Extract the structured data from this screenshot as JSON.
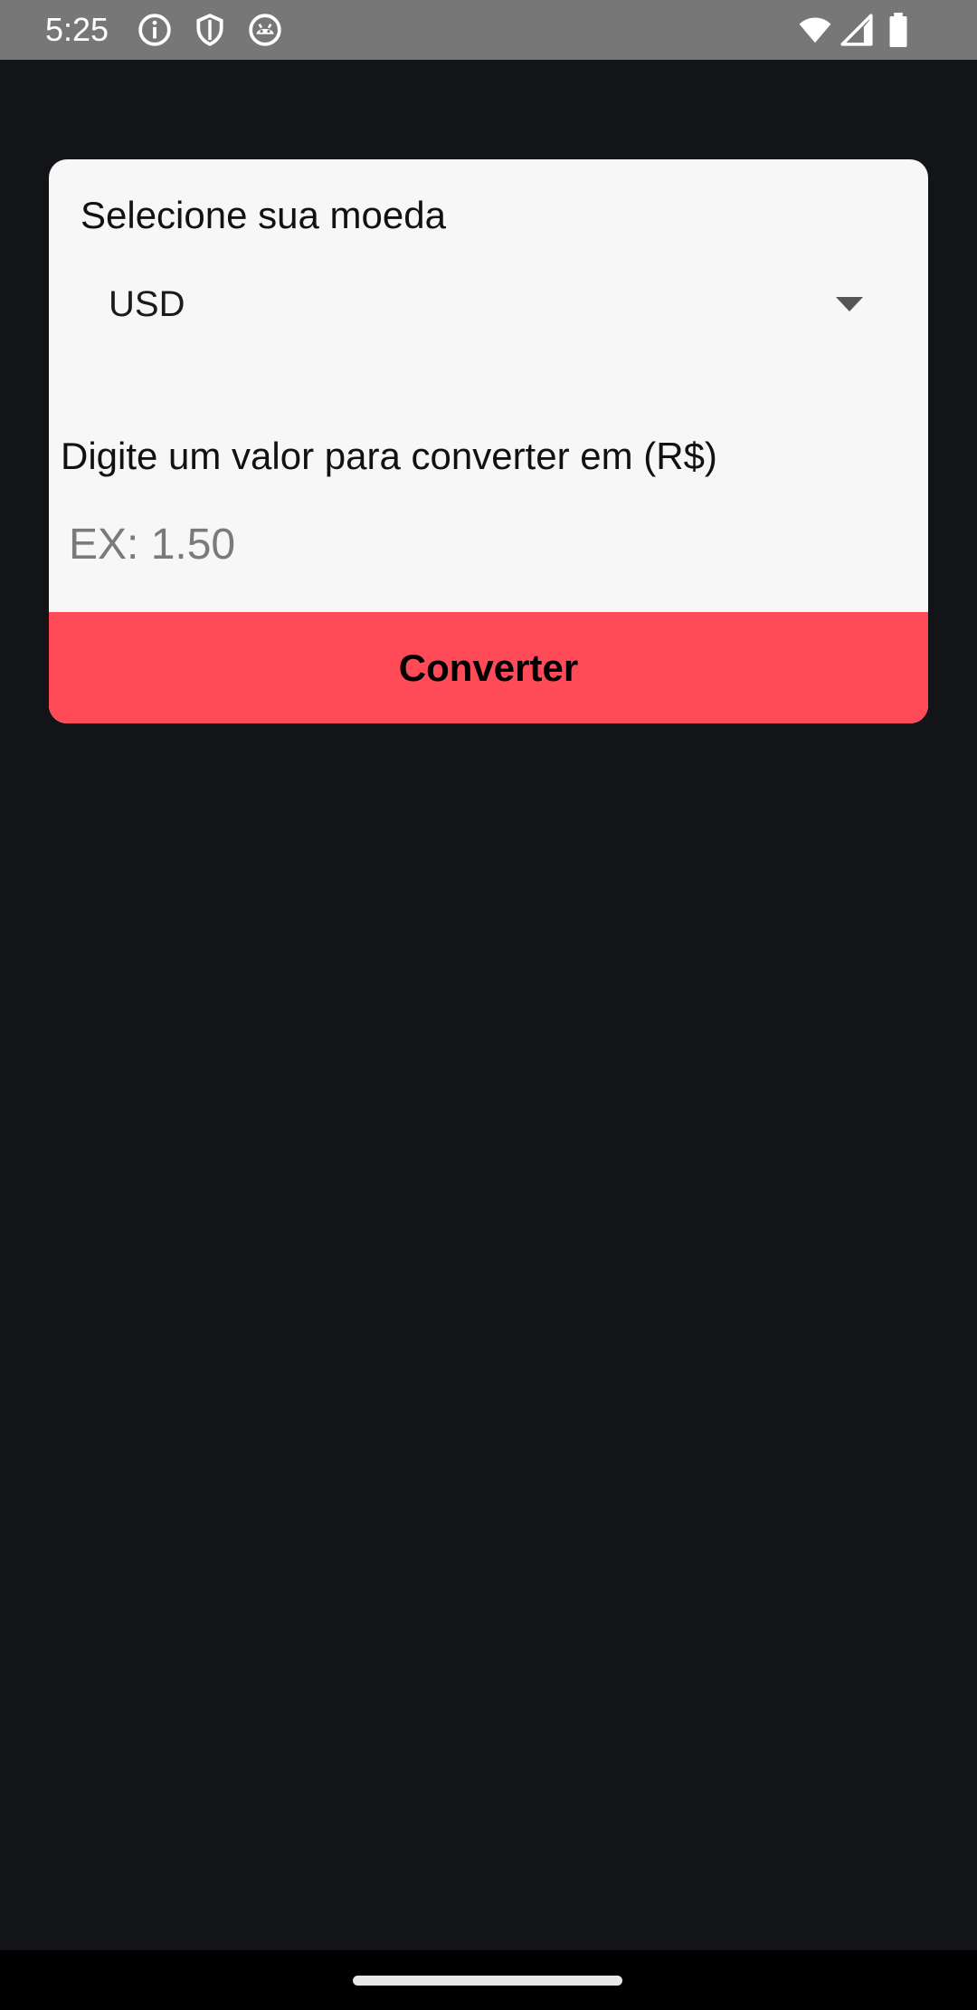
{
  "status_bar": {
    "time": "5:25",
    "icons_left": [
      "info-icon",
      "shield-icon",
      "android-icon"
    ],
    "icons_right": [
      "wifi-icon",
      "cell-signal-icon",
      "battery-icon"
    ]
  },
  "colors": {
    "background": "#131418",
    "card": "#f7f7f7",
    "accent": "#ff4b57",
    "status_bar": "#777777"
  },
  "converter": {
    "select_label": "Selecione sua moeda",
    "selected_currency": "USD",
    "value_label": "Digite um valor para converter em (R$)",
    "input_value": "",
    "input_placeholder": "EX: 1.50",
    "convert_button": "Converter"
  }
}
